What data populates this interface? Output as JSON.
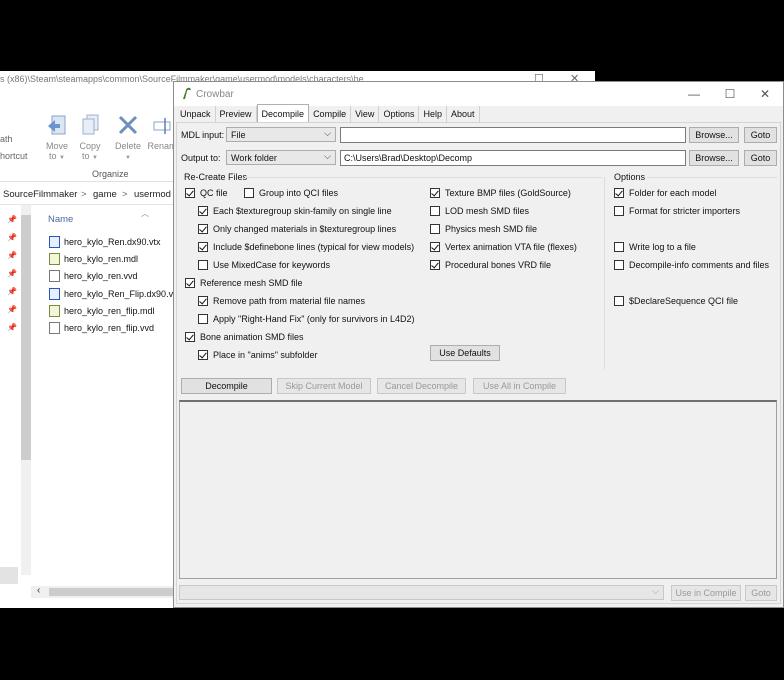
{
  "explorer": {
    "path_title": "s (x86)\\Steam\\steamapps\\common\\SourceFilmmaker\\game\\usermod\\models\\characters\\he",
    "ribbon_left_labels": [
      "ath",
      "hortcut"
    ],
    "buttons": [
      {
        "label": "Move",
        "sub": "to",
        "icon": "move-to-icon"
      },
      {
        "label": "Copy",
        "sub": "to",
        "icon": "copy-to-icon"
      },
      {
        "label": "Delete",
        "sub": "",
        "icon": "delete-icon"
      },
      {
        "label": "Renam",
        "sub": "",
        "icon": "rename-icon"
      }
    ],
    "group_label": "Organize",
    "breadcrumb": [
      "SourceFilmmaker",
      ">",
      "game",
      ">",
      "usermod"
    ],
    "column_header": "Name",
    "files": [
      {
        "name": "hero_kylo_Ren.dx90.vtx",
        "type": "vtx"
      },
      {
        "name": "hero_kylo_ren.mdl",
        "type": "mdl"
      },
      {
        "name": "hero_kylo_ren.vvd",
        "type": "vvd"
      },
      {
        "name": "hero_kylo_Ren_Flip.dx90.vtx",
        "type": "vtx"
      },
      {
        "name": "hero_kylo_ren_flip.mdl",
        "type": "mdl"
      },
      {
        "name": "hero_kylo_ren_flip.vvd",
        "type": "vvd"
      }
    ]
  },
  "crowbar": {
    "title": "Crowbar",
    "window_buttons": {
      "minimize": "—",
      "maximize": "☐",
      "close": "✕"
    },
    "tabs": [
      "Unpack",
      "Preview",
      "Decompile",
      "Compile",
      "View",
      "Options",
      "Help",
      "About"
    ],
    "active_tab": "Decompile",
    "mdl_input": {
      "label": "MDL input:",
      "mode": "File",
      "value": "",
      "browse": "Browse...",
      "goto": "Goto"
    },
    "output_to": {
      "label": "Output to:",
      "mode": "Work folder",
      "value": "C:\\Users\\Brad\\Desktop\\Decomp",
      "browse": "Browse...",
      "goto": "Goto"
    },
    "recreate_header": "Re-Create Files",
    "options_header": "Options",
    "checks_left": [
      {
        "label": "QC file",
        "checked": true
      },
      {
        "label": "Group into QCI files",
        "checked": false
      },
      {
        "label": "Each $texturegroup skin-family on single line",
        "checked": true
      },
      {
        "label": "Only changed materials in $texturegroup lines",
        "checked": true
      },
      {
        "label": "Include $definebone lines (typical for view models)",
        "checked": true
      },
      {
        "label": "Use MixedCase for keywords",
        "checked": false
      },
      {
        "label": "Reference mesh SMD file",
        "checked": true
      },
      {
        "label": "Remove path from material file names",
        "checked": true
      },
      {
        "label": "Apply \"Right-Hand Fix\" (only for survivors in L4D2)",
        "checked": false
      },
      {
        "label": "Bone animation SMD files",
        "checked": true
      },
      {
        "label": "Place in \"anims\" subfolder",
        "checked": true
      }
    ],
    "checks_mid": [
      {
        "label": "Texture BMP files (GoldSource)",
        "checked": true
      },
      {
        "label": "LOD mesh SMD files",
        "checked": false
      },
      {
        "label": "Physics mesh SMD file",
        "checked": false
      },
      {
        "label": "Vertex animation VTA file (flexes)",
        "checked": true
      },
      {
        "label": "Procedural bones VRD file",
        "checked": true
      }
    ],
    "checks_right": [
      {
        "label": "Folder for each model",
        "checked": true
      },
      {
        "label": "Format for stricter importers",
        "checked": false
      },
      {
        "label": "Write log to a file",
        "checked": false
      },
      {
        "label": "Decompile-info comments and files",
        "checked": false
      },
      {
        "label": "$DeclareSequence QCI file",
        "checked": false
      }
    ],
    "use_defaults": "Use Defaults",
    "actions": [
      "Decompile",
      "Skip Current Model",
      "Cancel Decompile",
      "Use All in Compile"
    ],
    "bottom": {
      "combo": "",
      "use_in_compile": "Use in Compile",
      "goto": "Goto"
    }
  }
}
